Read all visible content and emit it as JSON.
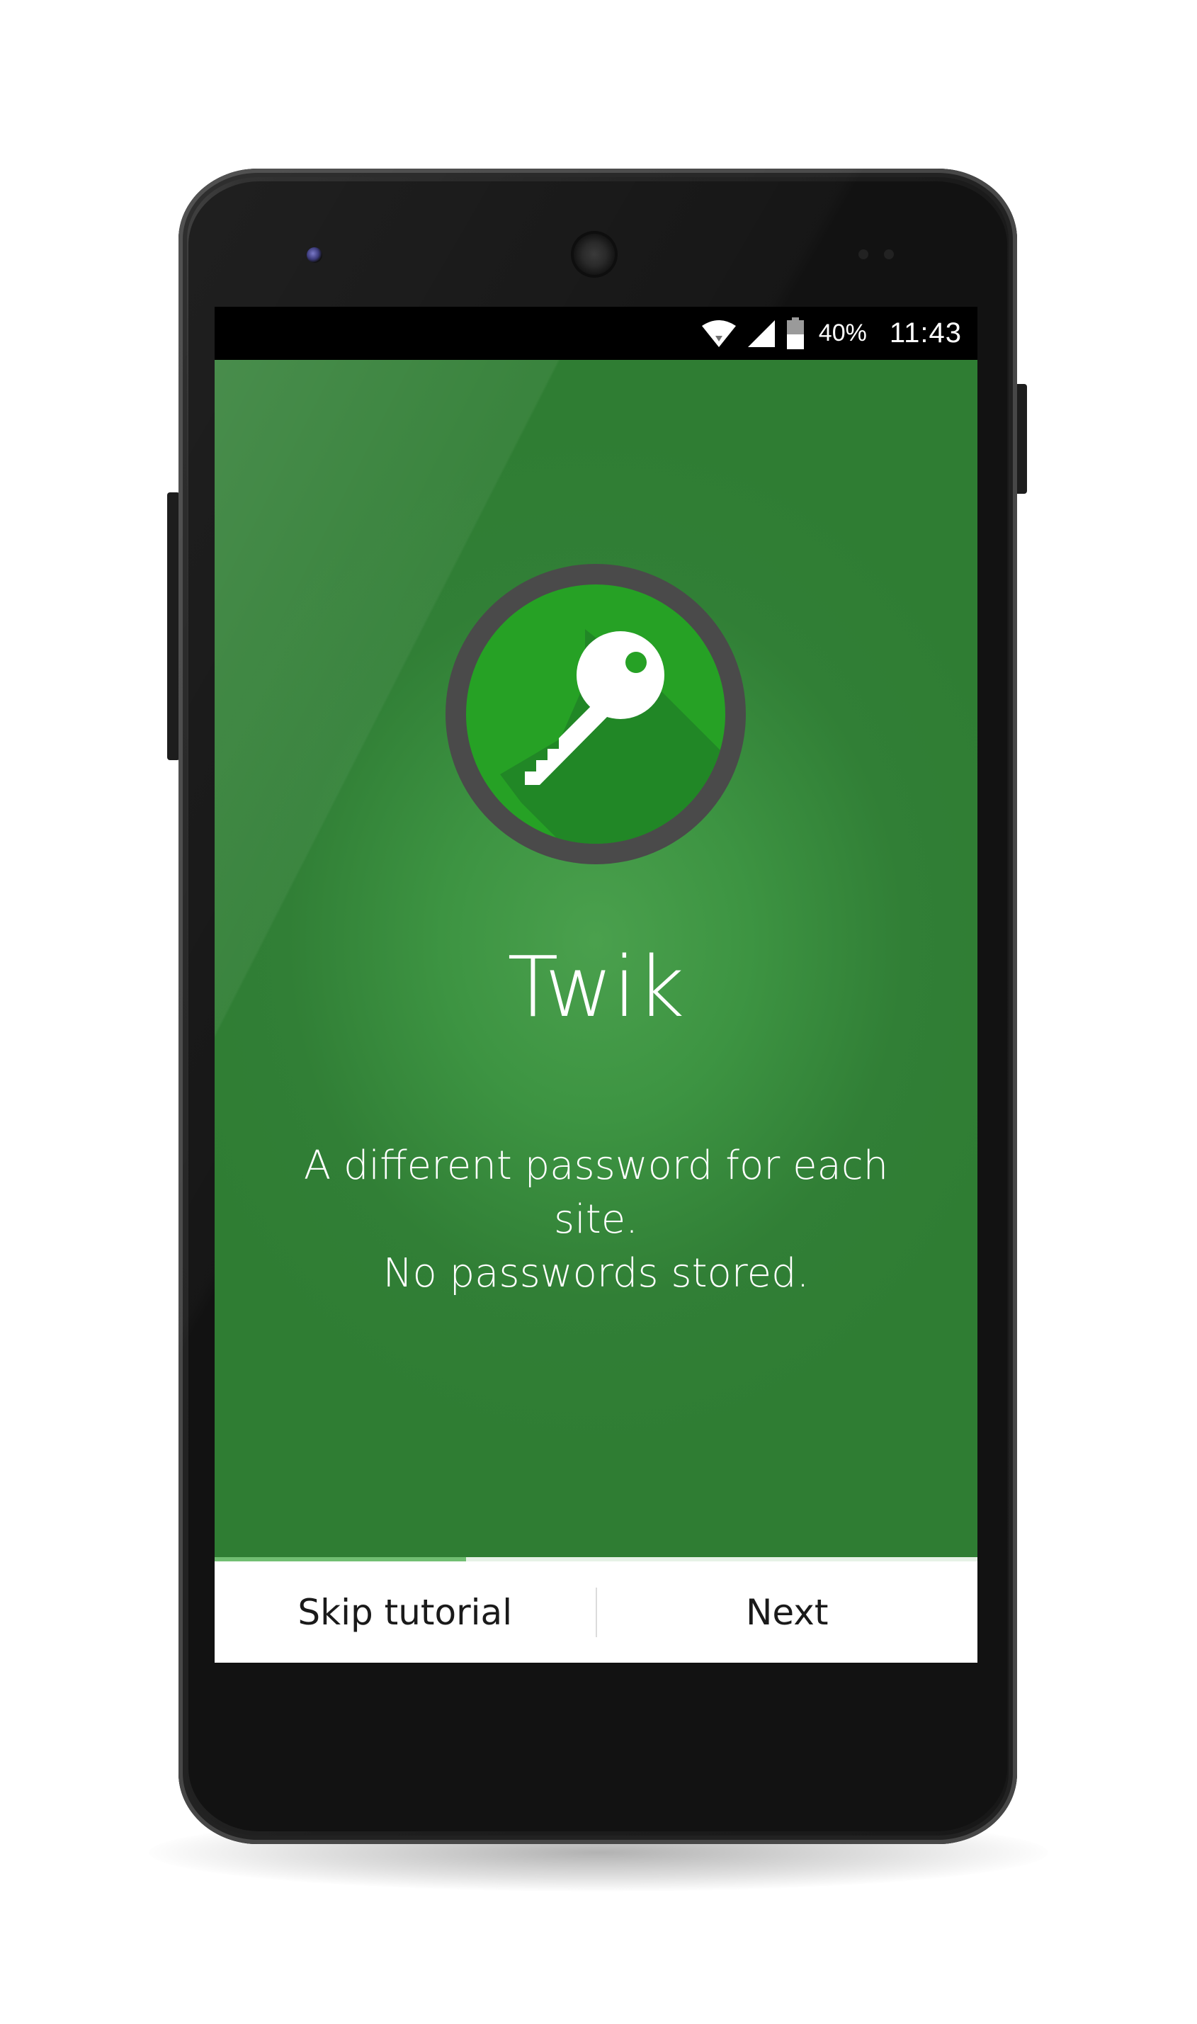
{
  "status_bar": {
    "battery_percent": "40%",
    "time": "11:43",
    "icons": [
      "wifi-icon",
      "signal-icon",
      "battery-icon"
    ]
  },
  "app": {
    "logo_icon": "key-icon",
    "title": "Twik",
    "tagline": {
      "line1": "A different password for each",
      "line2": "site.",
      "line3": "No passwords stored."
    },
    "tutorial_progress": 0.33
  },
  "bottom_bar": {
    "skip_label": "Skip tutorial",
    "next_label": "Next"
  },
  "colors": {
    "background_green": "#3a9140",
    "logo_green": "#26a125",
    "logo_ring": "#4a4a4a",
    "progress_fill": "#71be72",
    "text_white": "#ffffff"
  }
}
